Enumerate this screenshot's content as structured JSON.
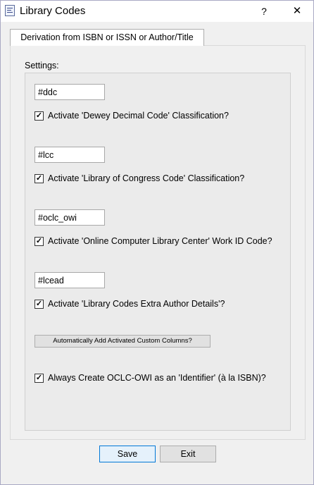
{
  "window": {
    "title": "Library Codes",
    "help_label": "?",
    "close_label": "✕",
    "app_icon": "library-document-icon"
  },
  "tabs": [
    {
      "label": "Derivation from ISBN or ISSN or Author/Title",
      "selected": true
    }
  ],
  "settings": {
    "group_label": "Settings:",
    "items": [
      {
        "field_value": "#ddc",
        "checkbox_label": "Activate 'Dewey Decimal Code' Classification?",
        "checked": true,
        "check_mark": "✓"
      },
      {
        "field_value": "#lcc",
        "checkbox_label": "Activate 'Library of Congress Code' Classification?",
        "checked": true,
        "check_mark": "✓"
      },
      {
        "field_value": "#oclc_owi",
        "checkbox_label": "Activate 'Online Computer Library Center' Work ID Code?",
        "checked": true,
        "check_mark": "✓"
      },
      {
        "field_value": "#lcead",
        "checkbox_label": "Activate 'Library Codes Extra Author Details'?",
        "checked": true,
        "check_mark": "✓"
      }
    ],
    "add_columns_button": "Automatically Add Activated Custom Columns?",
    "identifier_option": {
      "label": "Always Create OCLC-OWI as an 'Identifier' (à la ISBN)?",
      "checked": true,
      "check_mark": "✓"
    }
  },
  "footer": {
    "save_label": "Save",
    "exit_label": "Exit"
  },
  "colors": {
    "accent": "#0078d7",
    "window_bg": "#f0f0f0",
    "titlebar_bg": "#ffffff"
  }
}
